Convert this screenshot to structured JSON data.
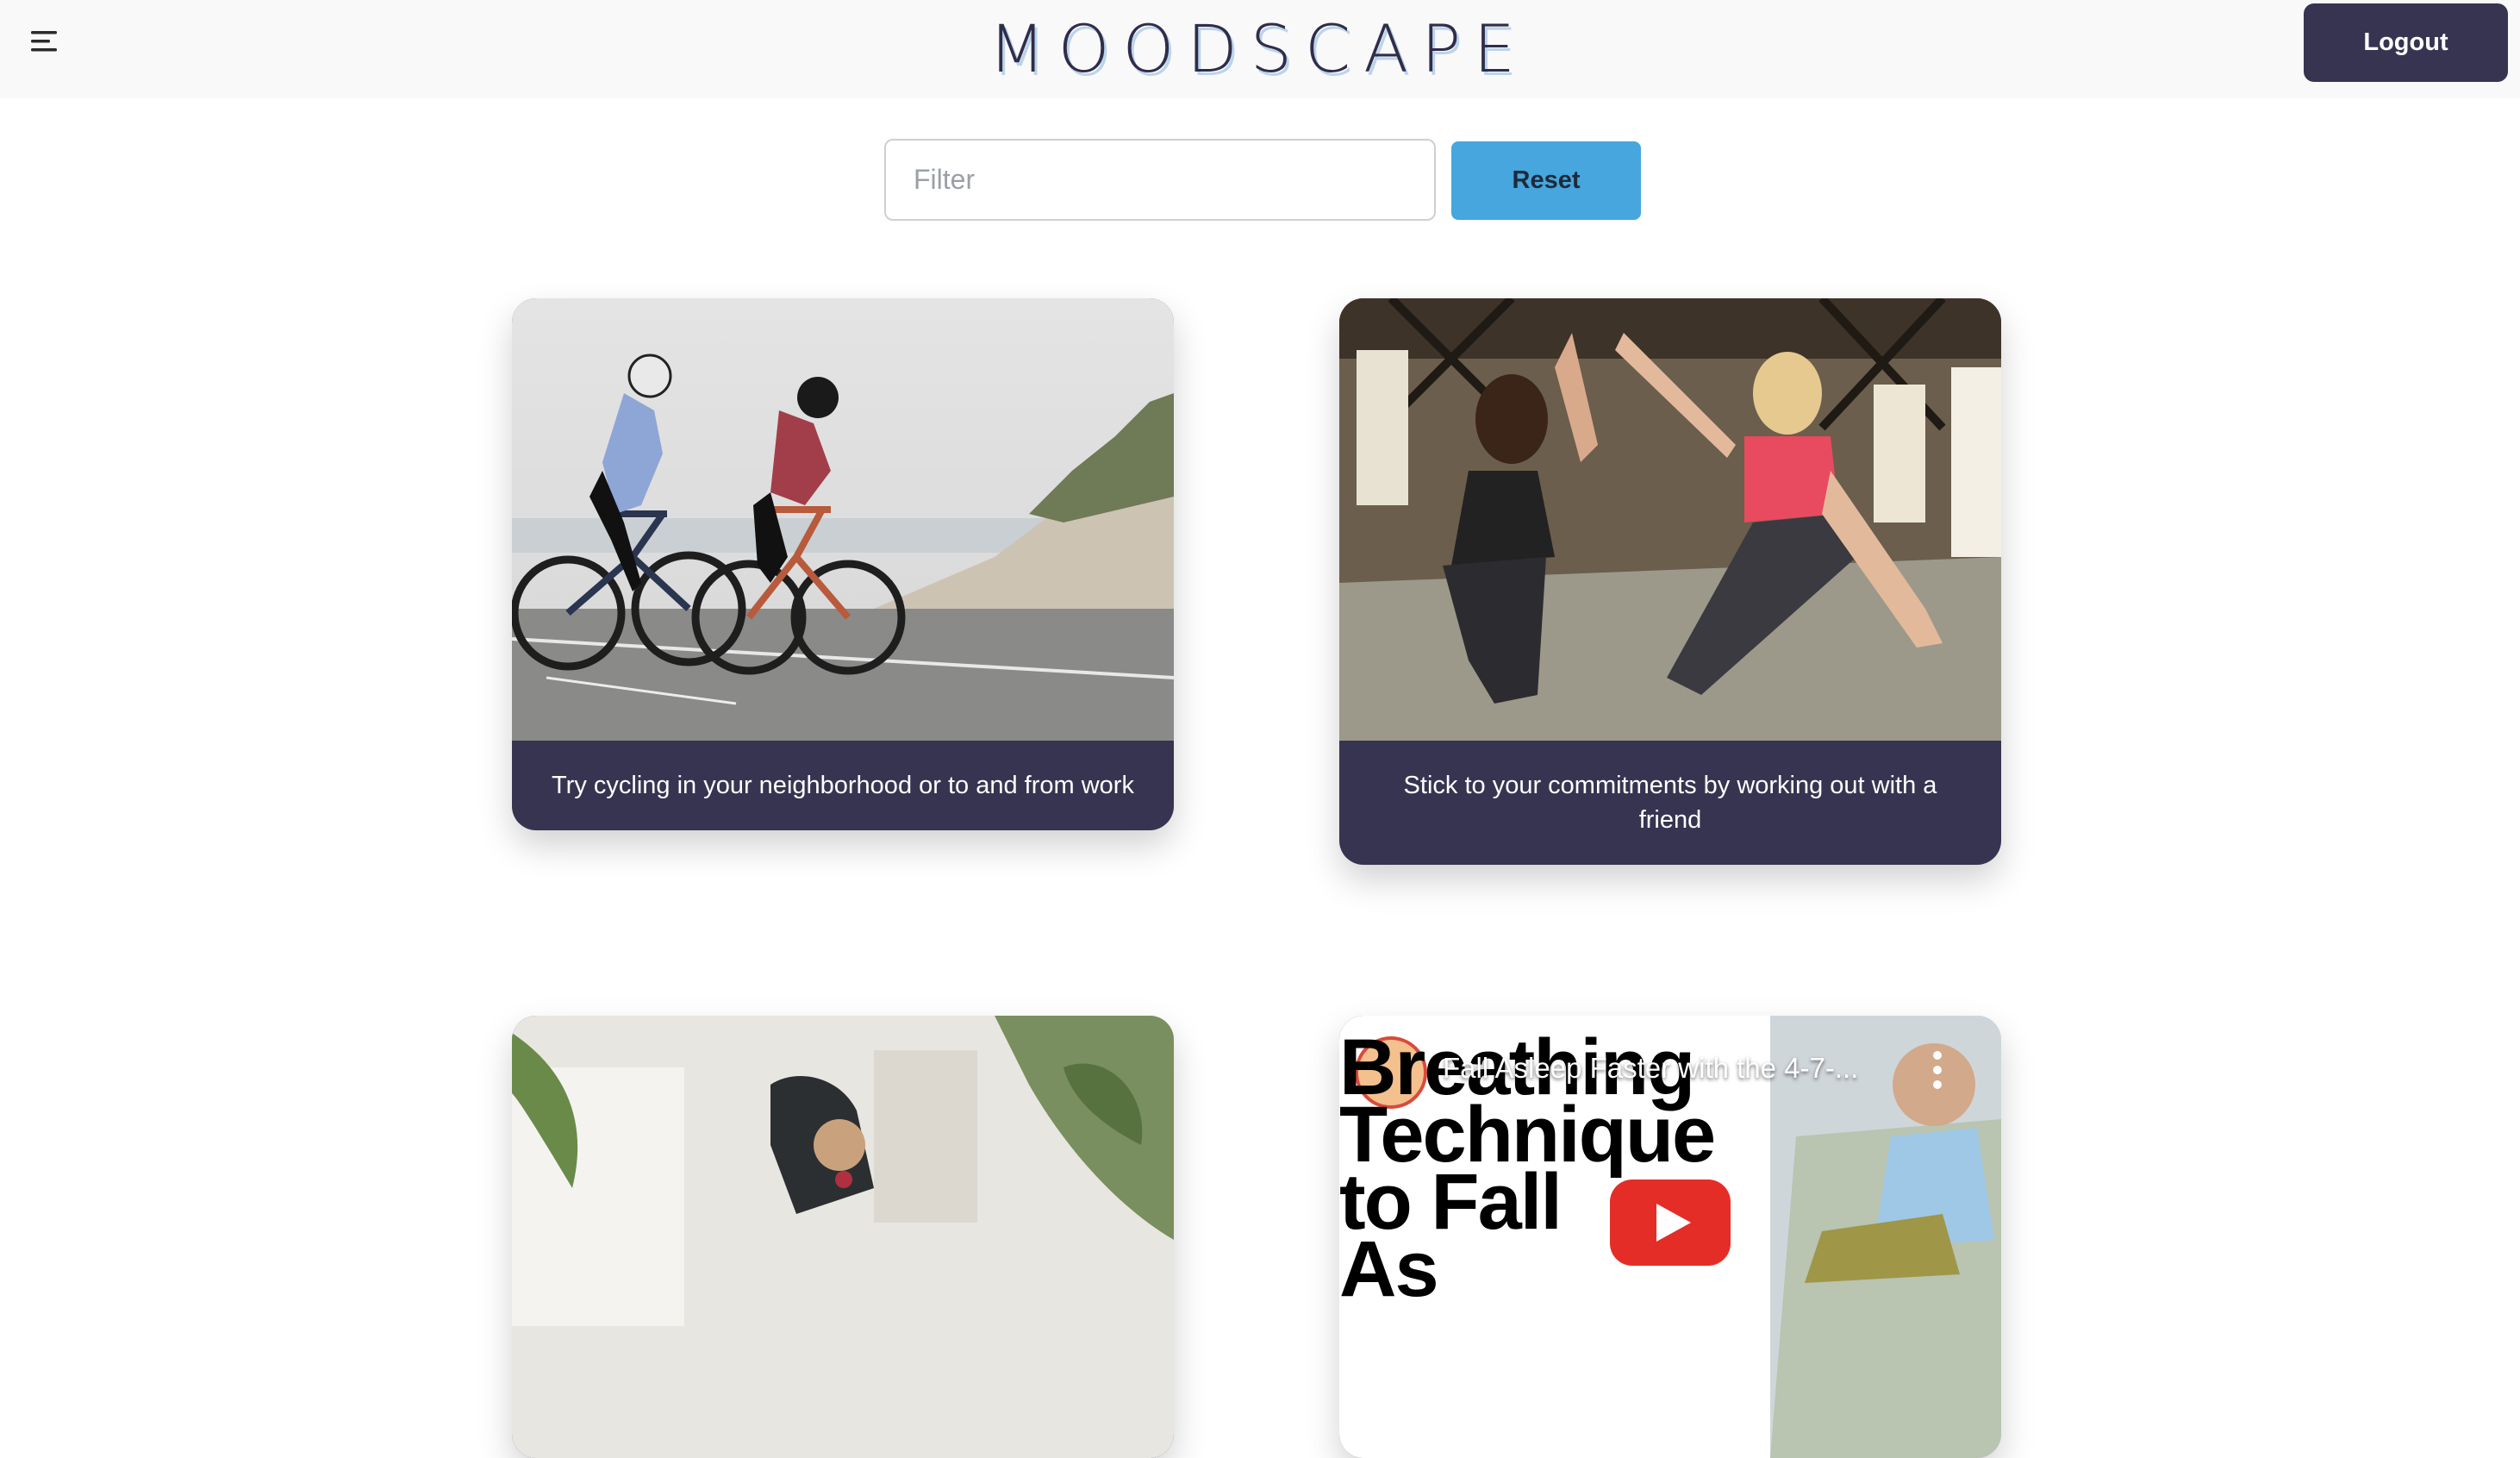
{
  "header": {
    "brand": "MOODSCAPE",
    "logout_label": "Logout",
    "menu_icon": "menu-lines-icon"
  },
  "filter": {
    "placeholder": "Filter",
    "value": "",
    "reset_label": "Reset"
  },
  "cards": [
    {
      "caption": "Try cycling in your neighborhood or to and from work",
      "media": "photo"
    },
    {
      "caption": "Stick to your commitments by working out with a friend",
      "media": "photo"
    },
    {
      "caption": "",
      "media": "photo"
    },
    {
      "caption": "",
      "media": "video",
      "video_title": "Fall Asleep Faster with the 4-7-...",
      "thumbnail_lines": [
        "Breathing",
        "Technique",
        "to Fall",
        "As"
      ],
      "play_icon": "youtube-play-icon",
      "more_icon": "more-vertical-icon"
    }
  ],
  "colors": {
    "header_bg": "#f9f9f9",
    "card_bg": "#373451",
    "accent": "#46a6dd",
    "logout_bg": "#373451"
  }
}
